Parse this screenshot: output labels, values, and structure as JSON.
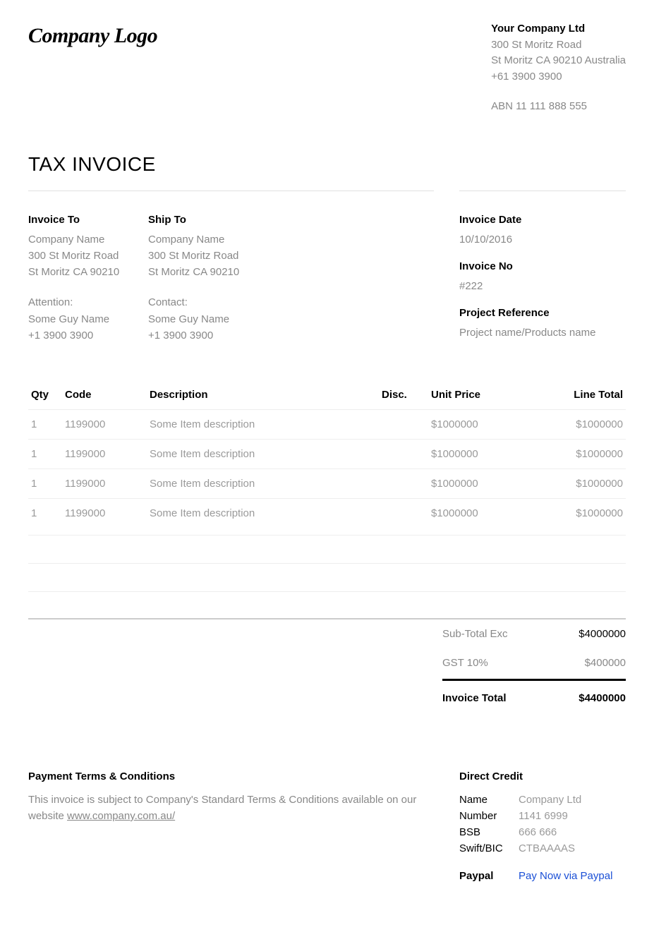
{
  "company": {
    "logo_text": "Company Logo",
    "name": "Your Company Ltd",
    "addr1": "300 St Moritz Road",
    "addr2": "St Moritz CA 90210  Australia",
    "phone": "+61 3900 3900",
    "abn": "ABN 11 111 888 555"
  },
  "doc_title": "TAX INVOICE",
  "invoice_to": {
    "heading": "Invoice To",
    "name": "Company Name",
    "addr1": "300 St Moritz Road",
    "addr2": "St Moritz CA 90210",
    "attn_label": "Attention:",
    "attn_name": "Some Guy Name",
    "attn_phone": "+1 3900 3900"
  },
  "ship_to": {
    "heading": "Ship To",
    "name": "Company Name",
    "addr1": "300 St Moritz Road",
    "addr2": "St Moritz CA 90210",
    "contact_label": "Contact:",
    "contact_name": "Some Guy Name",
    "contact_phone": "+1 3900 3900"
  },
  "meta": {
    "date_label": "Invoice Date",
    "date_value": "10/10/2016",
    "no_label": "Invoice No",
    "no_value": "#222",
    "ref_label": "Project Reference",
    "ref_value": "Project name/Products name"
  },
  "columns": {
    "qty": "Qty",
    "code": "Code",
    "desc": "Description",
    "disc": "Disc.",
    "unit": "Unit Price",
    "line": "Line Total"
  },
  "items": [
    {
      "qty": "1",
      "code": "1199000",
      "desc": "Some Item description",
      "disc": "",
      "unit": "$1000000",
      "line": "$1000000"
    },
    {
      "qty": "1",
      "code": "1199000",
      "desc": "Some Item description",
      "disc": "",
      "unit": "$1000000",
      "line": "$1000000"
    },
    {
      "qty": "1",
      "code": "1199000",
      "desc": "Some Item description",
      "disc": "",
      "unit": "$1000000",
      "line": "$1000000"
    },
    {
      "qty": "1",
      "code": "1199000",
      "desc": "Some Item description",
      "disc": "",
      "unit": "$1000000",
      "line": "$1000000"
    }
  ],
  "totals": {
    "sub_label": "Sub-Total Exc",
    "sub_value": "$4000000",
    "gst_label": "GST 10%",
    "gst_value": "$400000",
    "total_label": "Invoice Total",
    "total_value": "$4400000"
  },
  "terms": {
    "heading": "Payment Terms & Conditions",
    "text1": "This invoice is subject to Company's Standard Terms & Conditions available on our website ",
    "link": "www.company.com.au/"
  },
  "direct_credit": {
    "heading": "Direct Credit",
    "name_k": "Name",
    "name_v": "Company Ltd",
    "number_k": "Number",
    "number_v": "1141 6999",
    "bsb_k": "BSB",
    "bsb_v": "666 666",
    "swift_k": "Swift/BIC",
    "swift_v": "CTBAAAAS",
    "paypal_k": "Paypal",
    "paypal_v": "Pay Now via Paypal"
  }
}
